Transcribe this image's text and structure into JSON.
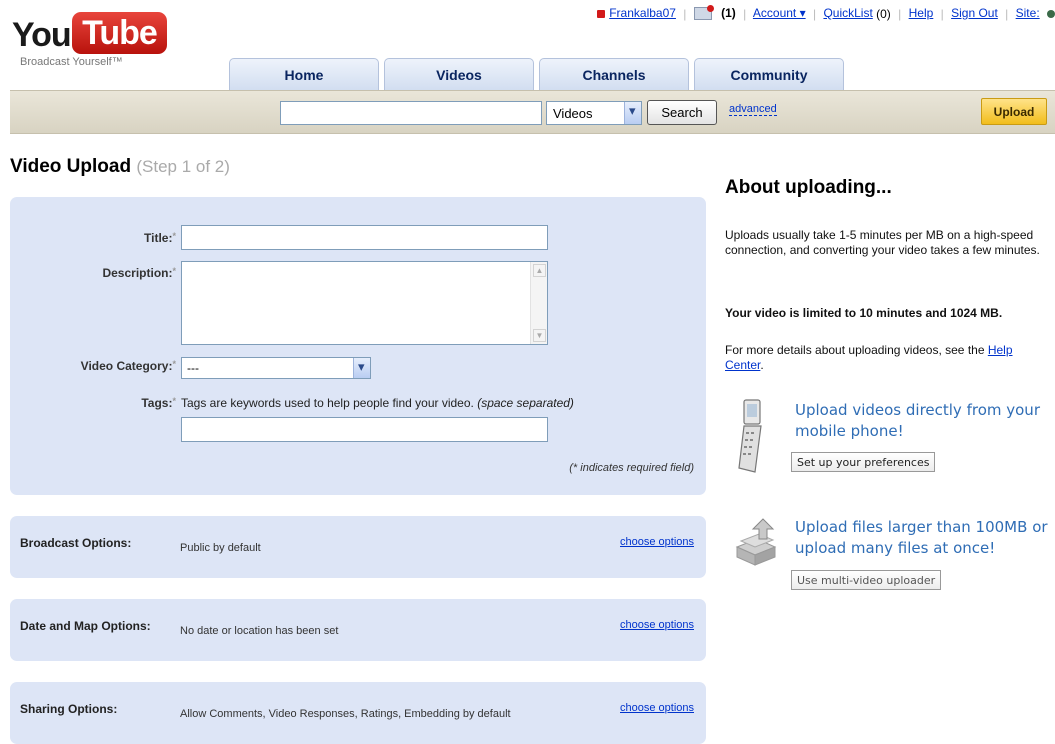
{
  "logo": {
    "you": "You",
    "tube": "Tube",
    "tagline": "Broadcast Yourself™"
  },
  "utility": {
    "username": "Frankalba07",
    "inbox_count": "(1)",
    "account": "Account ▾",
    "quicklist": "QuickList",
    "quicklist_count": "(0)",
    "help": "Help",
    "sign_out": "Sign Out",
    "site": "Site:"
  },
  "tabs": [
    {
      "label": "Home"
    },
    {
      "label": "Videos"
    },
    {
      "label": "Channels"
    },
    {
      "label": "Community"
    }
  ],
  "search": {
    "value": "",
    "category": "Videos",
    "button": "Search",
    "advanced": "advanced",
    "upload": "Upload"
  },
  "page": {
    "title": "Video Upload",
    "step": "(Step 1 of 2)"
  },
  "form": {
    "title_label": "Title:",
    "description_label": "Description:",
    "category_label": "Video Category:",
    "category_value": "---",
    "tags_label": "Tags:",
    "tags_hint": "Tags are keywords used to help people find your video.",
    "tags_hint_italic": "(space separated)",
    "required_note": "(* indicates required field)",
    "req_mark": "*"
  },
  "options": [
    {
      "label": "Broadcast Options:",
      "desc": "Public by default",
      "link": "choose options"
    },
    {
      "label": "Date and Map Options:",
      "desc": "No date or location has been set",
      "link": "choose options"
    },
    {
      "label": "Sharing Options:",
      "desc": "Allow Comments, Video Responses, Ratings, Embedding by default",
      "link": "choose options"
    }
  ],
  "sidebar": {
    "title": "About uploading...",
    "p1": "Uploads usually take 1-5 minutes per MB on a high-speed connection, and converting your video takes a few minutes.",
    "p2": "Your video is limited to 10 minutes and 1024 MB.",
    "p3_pre": "For more details about uploading videos, see the ",
    "p3_link": "Help Center",
    "p3_post": ".",
    "mobile_promo": "Upload videos directly from your mobile phone!",
    "mobile_button": "Set up your preferences",
    "multi_promo": "Upload files larger than 100MB or upload many files at once!",
    "multi_button": "Use multi-video uploader"
  }
}
